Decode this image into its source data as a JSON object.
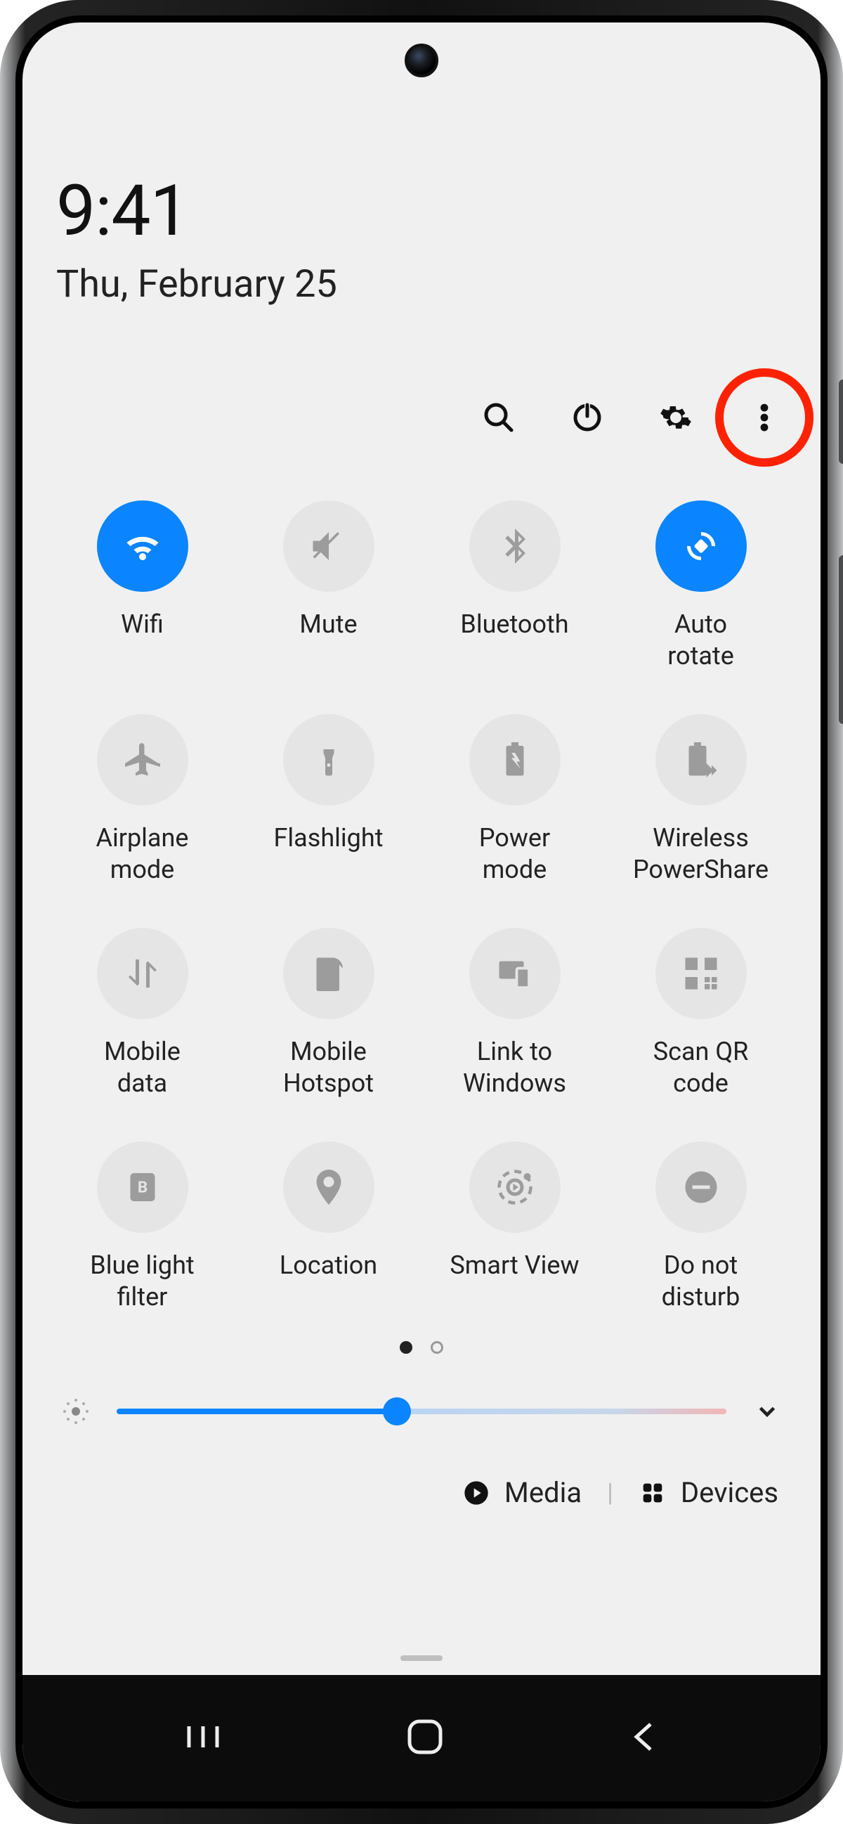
{
  "clock": {
    "time": "9:41",
    "date": "Thu, February 25"
  },
  "colors": {
    "accent": "#0a84ff",
    "highlight": "#ff2200"
  },
  "topbar": {
    "search": "search-icon",
    "power": "power-icon",
    "settings": "gear-icon",
    "more": "more-vertical-icon",
    "highlighted": "more"
  },
  "tiles": [
    {
      "id": "wifi",
      "label": "Wifi",
      "active": true
    },
    {
      "id": "mute",
      "label": "Mute",
      "active": false
    },
    {
      "id": "bluetooth",
      "label": "Bluetooth",
      "active": false
    },
    {
      "id": "auto-rotate",
      "label": "Auto\nrotate",
      "active": true
    },
    {
      "id": "airplane",
      "label": "Airplane\nmode",
      "active": false
    },
    {
      "id": "flashlight",
      "label": "Flashlight",
      "active": false
    },
    {
      "id": "power-mode",
      "label": "Power\nmode",
      "active": false
    },
    {
      "id": "powershare",
      "label": "Wireless\nPowerShare",
      "active": false
    },
    {
      "id": "mobile-data",
      "label": "Mobile\ndata",
      "active": false
    },
    {
      "id": "hotspot",
      "label": "Mobile\nHotspot",
      "active": false
    },
    {
      "id": "link-windows",
      "label": "Link to\nWindows",
      "active": false
    },
    {
      "id": "scan-qr",
      "label": "Scan QR\ncode",
      "active": false
    },
    {
      "id": "blue-light",
      "label": "Blue light\nfilter",
      "active": false
    },
    {
      "id": "location",
      "label": "Location",
      "active": false
    },
    {
      "id": "smart-view",
      "label": "Smart View",
      "active": false
    },
    {
      "id": "dnd",
      "label": "Do not\ndisturb",
      "active": false
    }
  ],
  "pager": {
    "current": 0,
    "total": 2
  },
  "brightness": {
    "value_pct": 46
  },
  "footer": {
    "media_label": "Media",
    "devices_label": "Devices"
  }
}
